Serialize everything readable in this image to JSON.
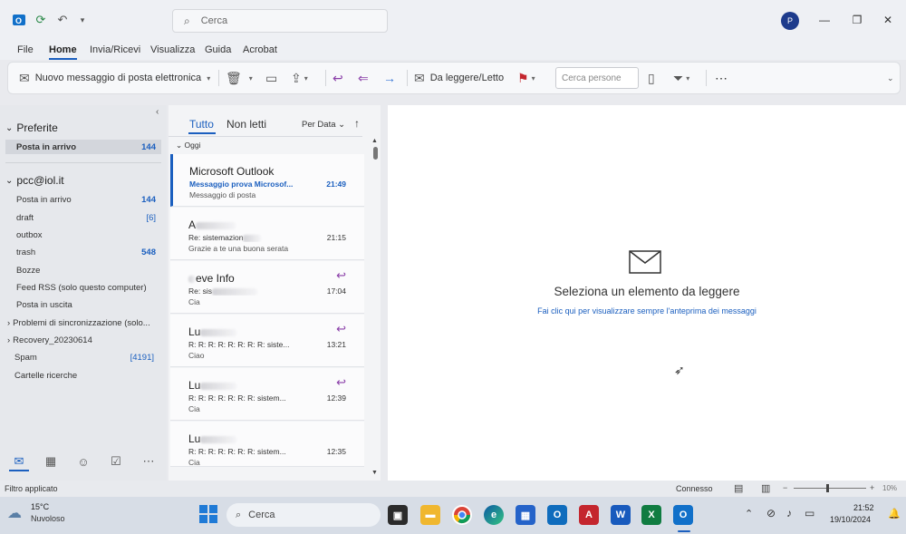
{
  "titlebar": {
    "search_placeholder": "Cerca",
    "avatar_initial": "P"
  },
  "menu": [
    "File",
    "Home",
    "Invia/Ricevi",
    "Visualizza",
    "Guida",
    "Acrobat"
  ],
  "ribbon": {
    "new_message": "Nuovo messaggio di posta elettronica",
    "read_unread": "Da leggere/Letto",
    "people_search_placeholder": "Cerca persone"
  },
  "folders": {
    "favorites_header": "Preferite",
    "favorites": [
      {
        "label": "Posta in arrivo",
        "count": "144"
      }
    ],
    "account_header": "pcc@iol.it",
    "items": [
      {
        "label": "Posta in arrivo",
        "count": "144"
      },
      {
        "label": "draft",
        "count": "[6]"
      },
      {
        "label": "outbox",
        "count": ""
      },
      {
        "label": "trash",
        "count": "548"
      },
      {
        "label": "Bozze",
        "count": ""
      },
      {
        "label": "Feed RSS (solo questo computer)",
        "count": ""
      },
      {
        "label": "Posta in uscita",
        "count": ""
      },
      {
        "label": "Problemi di sincronizzazione (solo...",
        "count": ""
      },
      {
        "label": "Recovery_20230614",
        "count": ""
      },
      {
        "label": "Spam",
        "count": "[4191]"
      },
      {
        "label": "Cartelle ricerche",
        "count": ""
      }
    ]
  },
  "list": {
    "tab_all": "Tutto",
    "tab_unread": "Non letti",
    "sort": "Per Data",
    "group": "Oggi",
    "messages": [
      {
        "from": "Microsoft Outlook",
        "subject": "Messaggio prova Microsof...",
        "preview": "Messaggio di posta",
        "time": "21:49"
      },
      {
        "from": "A",
        "subject": "Re: sistemazion",
        "preview": "Grazie a te una buona serata",
        "time": "21:15"
      },
      {
        "from": "eve Info",
        "subject": "Re: sis",
        "preview": "Cia",
        "time": "17:04"
      },
      {
        "from": "Lu",
        "subject": "R: R: R: R: R: R: R: R: siste...",
        "preview": "Ciao",
        "time": "13:21"
      },
      {
        "from": "Lu",
        "subject": "R: R: R: R: R: R: R: sistem...",
        "preview": "Cia",
        "time": "12:39"
      },
      {
        "from": "Lu",
        "subject": "R: R: R: R: R: R: R: sistem...",
        "preview": "Cia",
        "time": "12:35"
      }
    ]
  },
  "reading": {
    "title": "Seleziona un elemento da leggere",
    "link": "Fai clic qui per visualizzare sempre l'anteprima dei messaggi"
  },
  "status": {
    "left": "Filtro applicato",
    "connection": "Connesso",
    "zoom": "10%"
  },
  "taskbar": {
    "weather_temp": "15°C",
    "weather_desc": "Nuvoloso",
    "search": "Cerca",
    "time": "21:52",
    "date": "19/10/2024"
  }
}
